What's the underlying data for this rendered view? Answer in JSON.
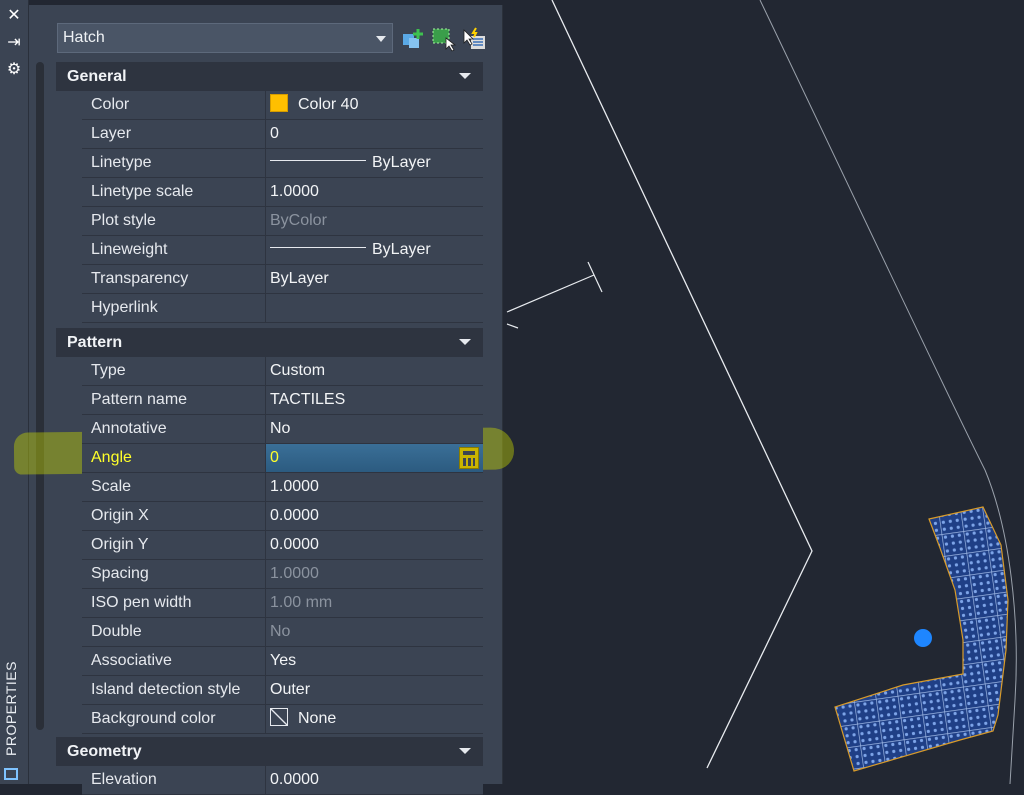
{
  "sidebar": {
    "tools": [
      {
        "icon": "close-icon",
        "glyph": "✕"
      },
      {
        "icon": "autohide-icon",
        "glyph": "⇥"
      },
      {
        "icon": "gear-icon",
        "glyph": "⚙"
      }
    ],
    "label": "PROPERTIES"
  },
  "toolbar": {
    "object_type": "Hatch",
    "buttons": [
      "toggle-pickadd-icon",
      "select-objects-icon",
      "quick-select-icon"
    ]
  },
  "sections": {
    "general": {
      "title": "General",
      "rows": [
        {
          "name": "Color",
          "value": "Color 40",
          "icon": "color-swatch",
          "swatch": "#ffbf00"
        },
        {
          "name": "Layer",
          "value": "0"
        },
        {
          "name": "Linetype",
          "value": "ByLayer",
          "icon": "line-icon"
        },
        {
          "name": "Linetype scale",
          "value": "1.0000"
        },
        {
          "name": "Plot style",
          "value": "ByColor",
          "disabled": true
        },
        {
          "name": "Lineweight",
          "value": "ByLayer",
          "icon": "line-icon"
        },
        {
          "name": "Transparency",
          "value": "ByLayer"
        },
        {
          "name": "Hyperlink",
          "value": ""
        }
      ]
    },
    "pattern": {
      "title": "Pattern",
      "rows": [
        {
          "name": "Type",
          "value": "Custom"
        },
        {
          "name": "Pattern name",
          "value": "TACTILES"
        },
        {
          "name": "Annotative",
          "value": "No"
        },
        {
          "name": "Angle",
          "value": "0",
          "active": true
        },
        {
          "name": "Scale",
          "value": "1.0000"
        },
        {
          "name": "Origin X",
          "value": "0.0000"
        },
        {
          "name": "Origin Y",
          "value": "0.0000"
        },
        {
          "name": "Spacing",
          "value": "1.0000",
          "disabled": true
        },
        {
          "name": "ISO pen width",
          "value": "1.00 mm",
          "disabled": true
        },
        {
          "name": "Double",
          "value": "No",
          "disabled": true
        },
        {
          "name": "Associative",
          "value": "Yes"
        },
        {
          "name": "Island detection style",
          "value": "Outer"
        },
        {
          "name": "Background color",
          "value": "None",
          "icon": "none-icon"
        }
      ]
    },
    "geometry": {
      "title": "Geometry",
      "rows": [
        {
          "name": "Elevation",
          "value": "0.0000"
        }
      ]
    }
  },
  "colors": {
    "panel": "#3b4453",
    "canvas": "#222732",
    "highlight": "#c7da00",
    "active_text": "#ffff2a",
    "hatch_fill": "#1f3f86",
    "grip": "#1e86ff"
  }
}
